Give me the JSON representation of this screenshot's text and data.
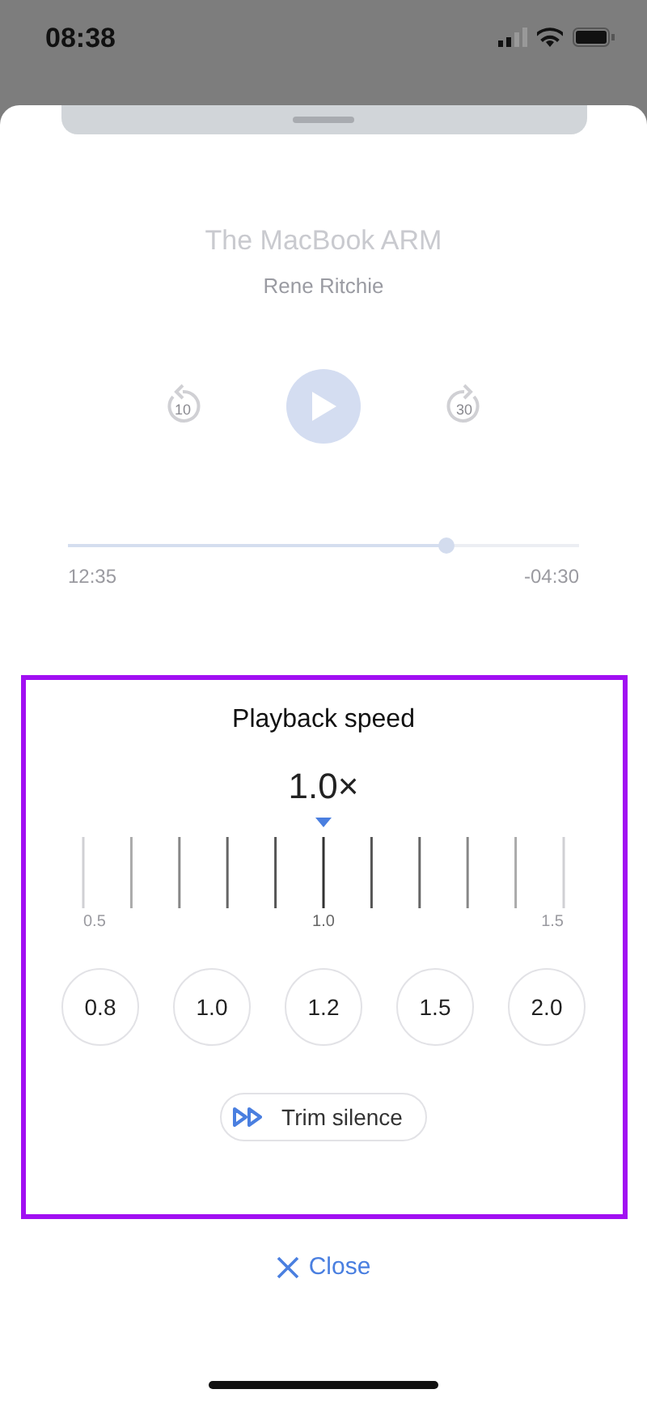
{
  "status_bar": {
    "time": "08:38"
  },
  "player": {
    "title": "The MacBook ARM",
    "author": "Rene Ritchie",
    "skip_back": "10",
    "skip_forward": "30",
    "progress": {
      "level": 0.74
    },
    "elapsed": "12:35",
    "remaining": "-04:30"
  },
  "speed_panel": {
    "title": "Playback speed",
    "value": "1.0×",
    "scale_labels": [
      "0.5",
      "1.0",
      "1.5"
    ],
    "presets": [
      "0.8",
      "1.0",
      "1.2",
      "1.5",
      "2.0"
    ],
    "trim_silence": "Trim silence"
  },
  "close": "Close"
}
